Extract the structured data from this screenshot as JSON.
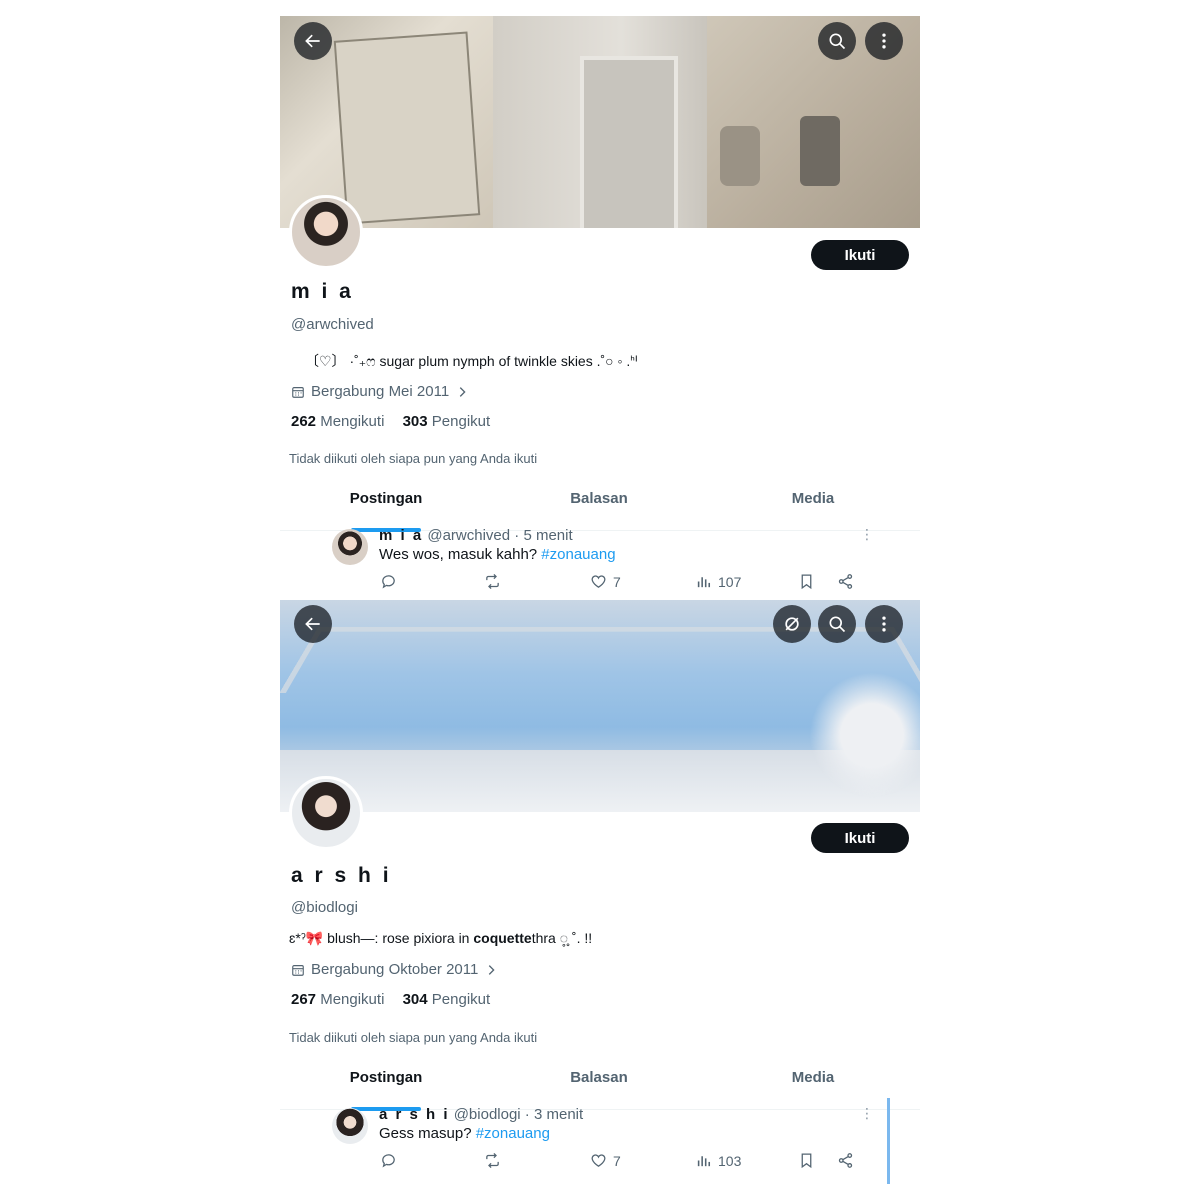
{
  "profiles": [
    {
      "name": "m i a",
      "handle": "@arwchived",
      "bio": "〔♡〕 ·˚₊ෆ sugar plum nymph of twinkle skies .˚○ ◦ .ᑋᑊ",
      "joined": "Bergabung Mei 2011",
      "following_count": "262",
      "following_label": "Mengikuti",
      "followers_count": "303",
      "followers_label": "Pengikut",
      "not_followed": "Tidak diikuti oleh siapa pun yang Anda ikuti",
      "follow_button": "Ikuti",
      "tabs": [
        "Postingan",
        "Balasan",
        "Media"
      ],
      "post": {
        "name": "m i a",
        "meta": "@arwchived · 5 menit",
        "text": "Wes wos, masuk kahh? ",
        "hashtag": "#zonauang",
        "likes": "7",
        "views": "107"
      }
    },
    {
      "name": "a r s h i",
      "handle": "@biodlogi",
      "bio_prefix": "ɛ*ˀ🎀 blush—: rose pixiora in ",
      "bio_bold": "coquette",
      "bio_suffix": "thra ◌̥̥ ˚. !!",
      "joined": "Bergabung Oktober 2011",
      "following_count": "267",
      "following_label": "Mengikuti",
      "followers_count": "304",
      "followers_label": "Pengikut",
      "not_followed": "Tidak diikuti oleh siapa pun yang Anda ikuti",
      "follow_button": "Ikuti",
      "tabs": [
        "Postingan",
        "Balasan",
        "Media"
      ],
      "post": {
        "name": "a r s h i",
        "meta": "@biodlogi · 3 menit",
        "text": "Gess masup? ",
        "hashtag": "#zonauang",
        "likes": "7",
        "views": "103"
      }
    }
  ],
  "icons": {
    "back": "arrow-left-icon",
    "search": "search-icon",
    "more": "more-vertical-icon",
    "grok": "grok-icon",
    "calendar": "calendar-icon",
    "chevron": "chevron-right-icon",
    "reply": "reply-icon",
    "retweet": "retweet-icon",
    "like": "heart-icon",
    "views": "views-icon",
    "bookmark": "bookmark-icon",
    "share": "share-icon"
  },
  "colors": {
    "accent": "#1d9bf0",
    "button": "#0f1419",
    "muted": "#536471"
  }
}
